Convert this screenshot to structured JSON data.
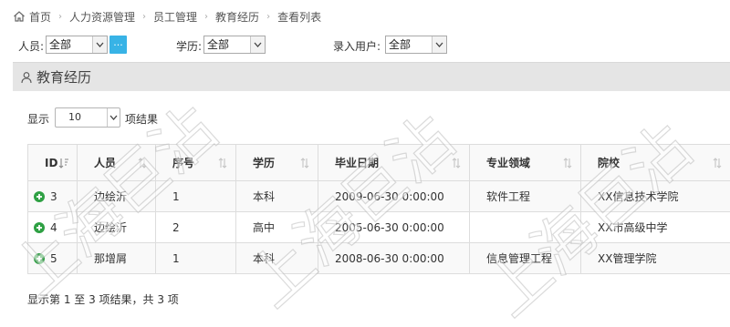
{
  "breadcrumb": [
    "首页",
    "人力资源管理",
    "员工管理",
    "教育经历",
    "查看列表"
  ],
  "filters": {
    "person_label": "人员:",
    "person_value": "全部",
    "pick_button": "...",
    "education_label": "学历:",
    "education_value": "全部",
    "entry_user_label": "录入用户:",
    "entry_user_value": "全部"
  },
  "section": {
    "title": "教育经历"
  },
  "length": {
    "show_label": "显示",
    "value": "10",
    "suffix_label": "项结果"
  },
  "table": {
    "columns": [
      "ID",
      "人员",
      "序号",
      "学历",
      "毕业日期",
      "专业领域",
      "院校"
    ],
    "rows": [
      {
        "id": "3",
        "person": "边绘沂",
        "seq": "1",
        "education": "本科",
        "grad_date": "2009-06-30 0:00:00",
        "major": "软件工程",
        "school": "XX信息技术学院"
      },
      {
        "id": "4",
        "person": "边绘沂",
        "seq": "2",
        "education": "高中",
        "grad_date": "2005-06-30 0:00:00",
        "major": "",
        "school": "XX市高级中学"
      },
      {
        "id": "5",
        "person": "那增屑",
        "seq": "1",
        "education": "本科",
        "grad_date": "2008-06-30 0:00:00",
        "major": "信息管理工程",
        "school": "XX管理学院"
      }
    ]
  },
  "info": "显示第 1 至 3 项结果，共 3 项",
  "watermark": "上海巨沾",
  "colors": {
    "accent": "#38b3e6",
    "add_green": "#2ea043",
    "header_bg": "#e5e5e5"
  }
}
